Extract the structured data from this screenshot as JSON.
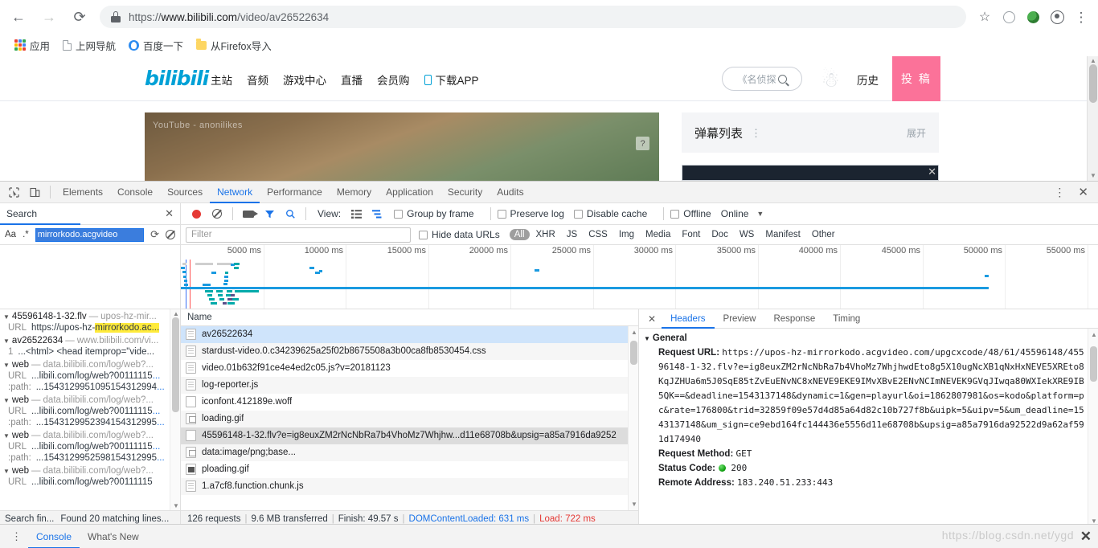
{
  "browser": {
    "back_icon": "←",
    "forward_icon": "→",
    "reload_icon": "⟳",
    "url_scheme": "https://",
    "url_host": "www.bilibili.com",
    "url_path": "/video/av26522634",
    "url_full": "https://www.bilibili.com/video/av26522634",
    "star_icon": "☆",
    "menu_icon": "⋮",
    "bookmarks": [
      {
        "label": "应用",
        "icon": "apps-grid-icon"
      },
      {
        "label": "上网导航",
        "icon": "page-icon"
      },
      {
        "label": "百度一下",
        "icon": "baidu-icon"
      },
      {
        "label": "从Firefox导入",
        "icon": "folder-icon"
      }
    ]
  },
  "bilibili": {
    "logo": "bilibili",
    "nav": [
      "主站",
      "音频",
      "游戏中心",
      "直播",
      "会员购"
    ],
    "download_app": "下载APP",
    "search_placeholder": "《名侦探",
    "history": "历史",
    "post": "投 稿",
    "video_watermark": "YouTube - anonilikes",
    "video_hint": "?",
    "danmu_title": "弹幕列表",
    "danmu_menu_icon": "⋮",
    "danmu_expand": "展开",
    "ad_close": "✕"
  },
  "devtools": {
    "inspect_icon": "inspect-element-icon",
    "device_icon": "device-toolbar-icon",
    "tabs": [
      "Elements",
      "Console",
      "Sources",
      "Network",
      "Performance",
      "Memory",
      "Application",
      "Security",
      "Audits"
    ],
    "active_tab": "Network",
    "more_icon": "⋮",
    "close_icon": "✕",
    "search": {
      "panel_label": "Search",
      "close_icon": "✕",
      "match_case_label": "Aa",
      "regex_label": ".*",
      "query_value": "mirrorkodo.acgvideo",
      "refresh_icon": "⟳",
      "clear_icon": "clear-icon",
      "status_left": "Search fin...",
      "status_right": "Found 20 matching lines..."
    },
    "network_toolbar": {
      "record_icon": "record-icon",
      "clear_icon": "clear-icon",
      "camera_icon": "camera-icon",
      "filter_icon": "filter-icon",
      "search_icon": "search-icon",
      "view_label": "View:",
      "list_view_icon": "list-view-icon",
      "waterfall_view_icon": "waterfall-view-icon",
      "group_by_frame": "Group by frame",
      "preserve_log": "Preserve log",
      "disable_cache": "Disable cache",
      "offline": "Offline",
      "throttling": "Online",
      "throttling_caret": "▼"
    },
    "filter_bar": {
      "placeholder": "Filter",
      "hide_data_urls": "Hide data URLs",
      "types": [
        "All",
        "XHR",
        "JS",
        "CSS",
        "Img",
        "Media",
        "Font",
        "Doc",
        "WS",
        "Manifest",
        "Other"
      ],
      "active_type": "All"
    },
    "timeline": {
      "ticks": [
        "5000 ms",
        "10000 ms",
        "15000 ms",
        "20000 ms",
        "25000 ms",
        "30000 ms",
        "35000 ms",
        "40000 ms",
        "45000 ms",
        "50000 ms",
        "55000 ms"
      ]
    },
    "search_results": [
      {
        "file": "45596148-1-32.flv",
        "dash": "—",
        "path": "upos-hz-mir...",
        "lines": [
          {
            "num": "URL",
            "pre": "https://upos-hz-",
            "hl": "mirrorkodo.ac",
            "post": "..."
          }
        ]
      },
      {
        "file": "av26522634",
        "dash": "—",
        "path": "www.bilibili.com/vi...",
        "lines": [
          {
            "num": "1",
            "pre": "...<html> <head itemprop=\"vide",
            "hl": "",
            "post": "..."
          }
        ]
      },
      {
        "file": "web",
        "dash": "—",
        "path": "data.bilibili.com/log/web?...",
        "lines": [
          {
            "num": "URL",
            "pre": "...libili.com/log/web?00111115",
            "hl": "",
            "post": "..."
          },
          {
            "num": ":path:",
            "pre": "...1543129951095154312994",
            "hl": "",
            "post": "..."
          }
        ]
      },
      {
        "file": "web",
        "dash": "—",
        "path": "data.bilibili.com/log/web?...",
        "lines": [
          {
            "num": "URL",
            "pre": "...libili.com/log/web?00111115",
            "hl": "",
            "post": "..."
          },
          {
            "num": ":path:",
            "pre": "...1543129952394154312995",
            "hl": "",
            "post": "..."
          }
        ]
      },
      {
        "file": "web",
        "dash": "—",
        "path": "data.bilibili.com/log/web?...",
        "lines": [
          {
            "num": "URL",
            "pre": "...libili.com/log/web?00111115",
            "hl": "",
            "post": "..."
          },
          {
            "num": ":path:",
            "pre": "...1543129952598154312995",
            "hl": "",
            "post": "..."
          }
        ]
      },
      {
        "file": "web",
        "dash": "—",
        "path": "data.bilibili.com/log/web?...",
        "lines": [
          {
            "num": "URL",
            "pre": "...libili.com/log/web?00111115",
            "hl": "",
            "post": ""
          }
        ]
      }
    ],
    "requests": {
      "column_name": "Name",
      "rows": [
        {
          "name": "av26522634",
          "type": "doc",
          "state": "selected"
        },
        {
          "name": "stardust-video.0.c34239625a25f02b8675508a3b00ca8fb8530454.css",
          "type": "doc",
          "state": "normal"
        },
        {
          "name": "video.01b632f91ce4e4ed2c05.js?v=20181123",
          "type": "doc",
          "state": "normal"
        },
        {
          "name": "log-reporter.js",
          "type": "doc",
          "state": "normal"
        },
        {
          "name": "iconfont.412189e.woff",
          "type": "plain",
          "state": "normal"
        },
        {
          "name": "loading.gif",
          "type": "img",
          "state": "normal"
        },
        {
          "name": "45596148-1-32.flv?e=ig8euxZM2rNcNbRa7b4VhoMz7Whjhw...d11e68708b&upsig=a85a7916da9252",
          "type": "plain",
          "state": "highlight"
        },
        {
          "name": "data:image/png;base...",
          "type": "img",
          "state": "normal"
        },
        {
          "name": "ploading.gif",
          "type": "gif",
          "state": "normal"
        },
        {
          "name": "1.a7cf8.function.chunk.js",
          "type": "doc",
          "state": "normal"
        }
      ],
      "status": {
        "requests": "126 requests",
        "transferred": "9.6 MB transferred",
        "finish": "Finish: 49.57 s",
        "dom_content_loaded": "DOMContentLoaded: 631 ms",
        "load": "Load: 722 ms",
        "separator": "|"
      }
    },
    "detail": {
      "close_icon": "✕",
      "tabs": [
        "Headers",
        "Preview",
        "Response",
        "Timing"
      ],
      "active_tab": "Headers",
      "section_title": "General",
      "section_tri": "▼",
      "request_url_label": "Request URL:",
      "request_url_value": "https://upos-hz-mirrorkodo.acgvideo.com/upgcxcode/48/61/45596148/45596148-1-32.flv?e=ig8euxZM2rNcNbRa7b4VhoMz7WhjhwdEto8g5X10ugNcXB1qNxHxNEVE5XREto8KqJZHUa6m5J0SqE85tZvEuENvNC8xNEVE9EKE9IMvXBvE2ENvNCImNEVEK9GVqJIwqa80WXIekXRE9IB5QK==&deadline=1543137148&dynamic=1&gen=playurl&oi=1862807981&os=kodo&platform=pc&rate=176800&trid=32859f09e57d4d85a64d82c10b727f8b&uipk=5&uipv=5&um_deadline=1543137148&um_sign=ce9ebd164fc144436e5556d11e68708b&upsig=a85a7916da92522d9a62af591d174940",
      "request_method_label": "Request Method:",
      "request_method_value": "GET",
      "status_code_label": "Status Code:",
      "status_code_value": "200",
      "remote_address_label": "Remote Address:",
      "remote_address_value": "183.240.51.233:443"
    },
    "drawer": {
      "dots_icon": "⋮",
      "tabs": [
        "Console",
        "What's New"
      ],
      "active_tab": "Console"
    }
  },
  "watermark": {
    "text": "https://blog.csdn.net/ygd",
    "close_icon": "✕"
  },
  "colors": {
    "accent_blue": "#1a73e8",
    "bili_blue": "#00a1d6",
    "bili_pink": "#fb7299",
    "status_green": "#0a9a0a",
    "error_red": "#e53935",
    "highlight_yellow": "#ffeb3b"
  }
}
